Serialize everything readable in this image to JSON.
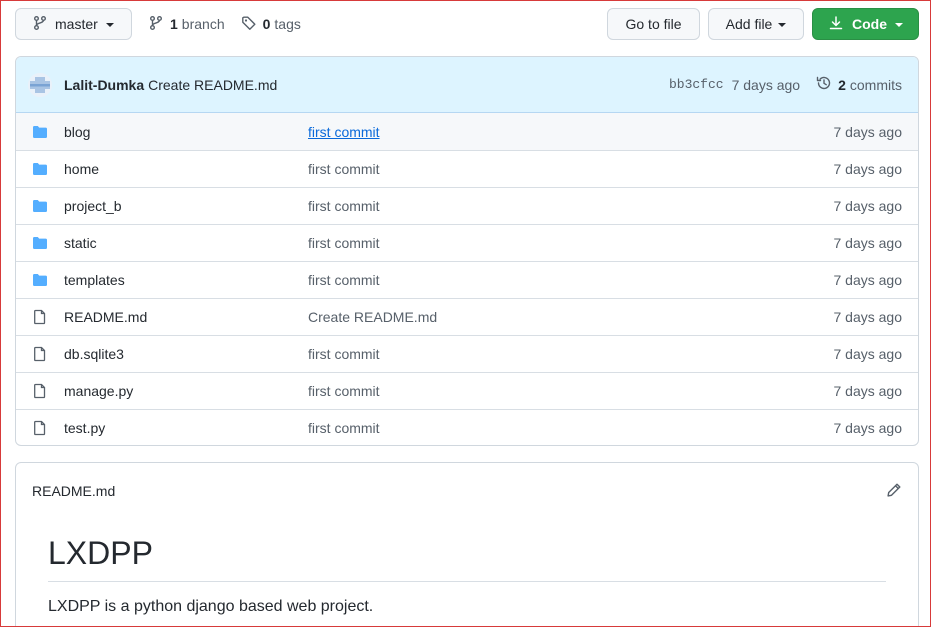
{
  "toolbar": {
    "branch_label": "master",
    "branches_count": "1",
    "branches_word": "branch",
    "tags_count": "0",
    "tags_word": "tags",
    "goto_label": "Go to file",
    "addfile_label": "Add file",
    "code_label": "Code"
  },
  "commit": {
    "author": "Lalit-Dumka",
    "message": "Create README.md",
    "sha": "bb3cfcc",
    "age": "7 days ago",
    "commits_count": "2",
    "commits_word": "commits"
  },
  "files": [
    {
      "name": "blog",
      "type": "folder",
      "message": "first commit",
      "age": "7 days ago"
    },
    {
      "name": "home",
      "type": "folder",
      "message": "first commit",
      "age": "7 days ago"
    },
    {
      "name": "project_b",
      "type": "folder",
      "message": "first commit",
      "age": "7 days ago"
    },
    {
      "name": "static",
      "type": "folder",
      "message": "first commit",
      "age": "7 days ago"
    },
    {
      "name": "templates",
      "type": "folder",
      "message": "first commit",
      "age": "7 days ago"
    },
    {
      "name": "README.md",
      "type": "file",
      "message": "Create README.md",
      "age": "7 days ago"
    },
    {
      "name": "db.sqlite3",
      "type": "file",
      "message": "first commit",
      "age": "7 days ago"
    },
    {
      "name": "manage.py",
      "type": "file",
      "message": "first commit",
      "age": "7 days ago"
    },
    {
      "name": "test.py",
      "type": "file",
      "message": "first commit",
      "age": "7 days ago"
    }
  ],
  "readme": {
    "filename": "README.md",
    "heading": "LXDPP",
    "paragraph": "LXDPP is a python django based web project."
  },
  "colors": {
    "folder": "#54aeff",
    "accent_green": "#2da44e",
    "link_blue": "#0969da",
    "commit_bar_bg": "#ddf4ff"
  }
}
